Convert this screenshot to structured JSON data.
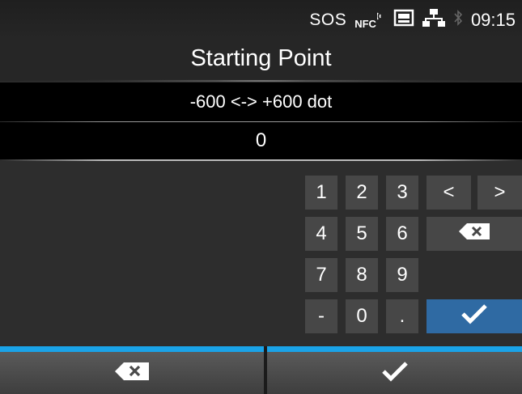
{
  "status": {
    "sos": "SOS",
    "nfc": "NFC",
    "time": "09:15"
  },
  "header": {
    "title": "Starting Point"
  },
  "range_text": "-600 <-> +600 dot",
  "value": "0",
  "keypad": {
    "digits": [
      "1",
      "2",
      "3",
      "4",
      "5",
      "6",
      "7",
      "8",
      "9"
    ],
    "minus": "-",
    "zero": "0",
    "dot": ".",
    "left": "<",
    "right": ">"
  },
  "colors": {
    "accent": "#1aa3e8",
    "ok": "#2f6aa3",
    "key": "#474747",
    "background": "#2d2d2d"
  }
}
